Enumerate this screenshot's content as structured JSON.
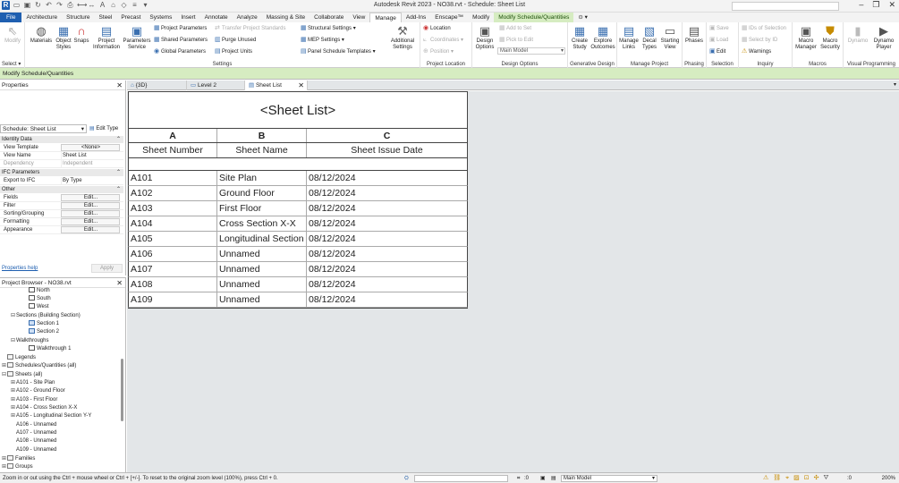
{
  "window": {
    "title": "Autodesk Revit 2023 - NO38.rvt - Schedule: Sheet List",
    "qat_icons": [
      "revit-logo-icon",
      "open-icon",
      "save-icon",
      "sync-icon",
      "undo-icon",
      "redo-icon",
      "print-icon",
      "measure-icon",
      "dimension-icon",
      "text-icon",
      "3d-view-icon",
      "section-icon",
      "thin-lines-icon",
      "close-hidden-icon",
      "switch-windows-icon"
    ]
  },
  "tabs": [
    "File",
    "Architecture",
    "Structure",
    "Steel",
    "Precast",
    "Systems",
    "Insert",
    "Annotate",
    "Analyze",
    "Massing & Site",
    "Collaborate",
    "View",
    "Manage",
    "Add-Ins",
    "Enscape™",
    "Modify",
    "Modify Schedule/Quantities"
  ],
  "active_tab": "Manage",
  "ribbon": {
    "select_panel": {
      "label": "Select ▾",
      "modify": "Modify"
    },
    "settings_panel": {
      "label": "Settings",
      "materials": "Materials",
      "object_styles": "Object Styles",
      "snaps": "Snaps",
      "project_information": "Project Information",
      "project_parameters": "Project Parameters",
      "shared_parameters": "Shared Parameters",
      "global_parameters": "Global Parameters",
      "transfer_project_standards": "Transfer Project Standards",
      "purge_unused": "Purge Unused",
      "project_units": "Project Units",
      "structural_settings": "Structural Settings ▾",
      "mep_settings": "MEP Settings ▾",
      "panel_schedule_templates": "Panel Schedule Templates ▾",
      "parameters_service": "Parameters Service",
      "additional_settings": "Additional Settings"
    },
    "project_location_panel": {
      "label": "Project Location",
      "location": "Location",
      "coordinates": "Coordinates ▾",
      "position": "Position ▾"
    },
    "design_options_panel": {
      "label": "Design Options",
      "design_options": "Design Options",
      "add_to_set": "Add to Set",
      "pick_to_edit": "Pick to Edit",
      "main_model": "Main Model"
    },
    "generative_design_panel": {
      "label": "Generative Design",
      "create_study": "Create Study",
      "explore_outcomes": "Explore Outcomes"
    },
    "manage_project_panel": {
      "label": "Manage Project",
      "manage_links": "Manage Links",
      "decal_types": "Decal Types",
      "starting_view": "Starting View"
    },
    "phasing_panel": {
      "label": "Phasing",
      "phases": "Phases"
    },
    "selection_panel": {
      "label": "Selection",
      "save": "Save",
      "load": "Load",
      "edit": "Edit"
    },
    "inquiry_panel": {
      "label": "Inquiry",
      "ids_of_selection": "IDs of Selection",
      "select_by_id": "Select by ID",
      "warnings": "Warnings"
    },
    "macros_panel": {
      "label": "Macros",
      "macro_manager": "Macro Manager",
      "macro_security": "Macro Security"
    },
    "visual_programming_panel": {
      "label": "Visual Programming",
      "dynamo": "Dynamo",
      "dynamo_player": "Dynamo Player"
    }
  },
  "options_bar": {
    "text": "Modify Schedule/Quantities"
  },
  "properties": {
    "title": "Properties",
    "type_selector": "Schedule: Sheet List",
    "edit_type": "Edit Type",
    "groups": {
      "identity": "Identity Data",
      "ifc": "IFC Parameters",
      "other": "Other"
    },
    "rows": {
      "view_template": {
        "key": "View Template",
        "value": "<None>"
      },
      "view_name": {
        "key": "View Name",
        "value": "Sheet List"
      },
      "dependency": {
        "key": "Dependency",
        "value": "Independent"
      },
      "export_to_ifc": {
        "key": "Export to IFC",
        "value": "By Type"
      },
      "fields": {
        "key": "Fields",
        "value": "Edit..."
      },
      "filter": {
        "key": "Filter",
        "value": "Edit..."
      },
      "sorting": {
        "key": "Sorting/Grouping",
        "value": "Edit..."
      },
      "formatting": {
        "key": "Formatting",
        "value": "Edit..."
      },
      "appearance": {
        "key": "Appearance",
        "value": "Edit..."
      }
    },
    "help": "Properties help",
    "apply": "Apply"
  },
  "browser": {
    "title": "Project Browser - NO38.rvt",
    "nodes": {
      "north": "North",
      "south": "South",
      "west": "West",
      "sections": "Sections (Building Section)",
      "section1": "Section 1",
      "section2": "Section 2",
      "walkthroughs": "Walkthroughs",
      "walkthrough1": "Walkthrough 1",
      "legends": "Legends",
      "schedules": "Schedules/Quantities (all)",
      "sheets": "Sheets (all)",
      "s101": "A101 - Site Plan",
      "s102": "A102 - Ground Floor",
      "s103": "A103 - First Floor",
      "s104": "A104 - Cross Section X-X",
      "s105": "A105 - Longitudinal Section Y-Y",
      "s106": "A106 - Unnamed",
      "s107": "A107 - Unnamed",
      "s108": "A108 - Unnamed",
      "s109": "A109 - Unnamed",
      "families": "Families",
      "groups": "Groups"
    }
  },
  "view_tabs": [
    "{3D}",
    "Level 2",
    "Sheet List"
  ],
  "schedule": {
    "title": "<Sheet List>",
    "letters": [
      "A",
      "B",
      "C"
    ],
    "headers": [
      "Sheet Number",
      "Sheet Name",
      "Sheet Issue Date"
    ],
    "rows": [
      [
        "A101",
        "Site Plan",
        "08/12/2024"
      ],
      [
        "A102",
        "Ground Floor",
        "08/12/2024"
      ],
      [
        "A103",
        "First Floor",
        "08/12/2024"
      ],
      [
        "A104",
        "Cross Section X-X",
        "08/12/2024"
      ],
      [
        "A105",
        "Longitudinal Section",
        "08/12/2024"
      ],
      [
        "A106",
        "Unnamed",
        "08/12/2024"
      ],
      [
        "A107",
        "Unnamed",
        "08/12/2024"
      ],
      [
        "A108",
        "Unnamed",
        "08/12/2024"
      ],
      [
        "A109",
        "Unnamed",
        "08/12/2024"
      ]
    ]
  },
  "status": {
    "message": "Zoom in or out using the Ctrl + mouse wheel or Ctrl + [+/-]. To reset to the original zoom level (100%), press Ctrl + 0.",
    "workset_value": ":0",
    "model": "Main Model",
    "filter_count": ":0",
    "zoom": "200%"
  }
}
